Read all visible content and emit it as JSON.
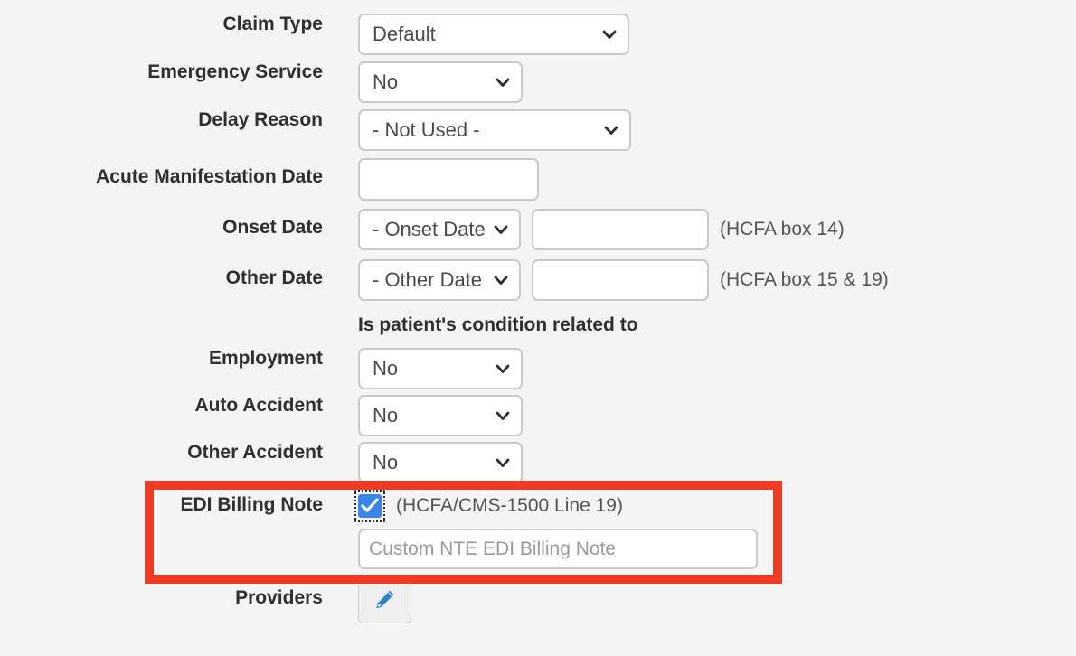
{
  "theme": {
    "page_background": "#f4f4f4",
    "label_color": "#2f2f2f",
    "field_border": "#c9c9c9",
    "field_background": "#ffffff",
    "hint_color": "#555555",
    "placeholder_color": "#9a9a9a",
    "highlight_color": "#ee3b24",
    "checkbox_checked_color": "#3a86e8",
    "pencil_icon_color": "#2f81c4"
  },
  "form": {
    "section_heading": "Is patient's condition related to",
    "rows": {
      "claim_type": {
        "label": "Claim Type",
        "select_value": "Default",
        "chevron_icon": "chevron-down-icon"
      },
      "emergency_service": {
        "label": "Emergency Service",
        "select_value": "No",
        "chevron_icon": "chevron-down-icon"
      },
      "delay_reason": {
        "label": "Delay Reason",
        "select_value": "- Not Used -",
        "chevron_icon": "chevron-down-icon"
      },
      "acute_manifestation_date": {
        "label": "Acute Manifestation Date",
        "input_value": "",
        "placeholder": ""
      },
      "onset_date": {
        "label": "Onset Date",
        "select_value": "- Onset Date -",
        "input_value": "",
        "placeholder": "",
        "hint": "(HCFA box 14)",
        "chevron_icon": "chevron-down-icon"
      },
      "other_date": {
        "label": "Other Date",
        "select_value": "- Other Date -",
        "input_value": "",
        "placeholder": "",
        "hint": "(HCFA box 15 & 19)",
        "chevron_icon": "chevron-down-icon"
      },
      "employment": {
        "label": "Employment",
        "select_value": "No",
        "chevron_icon": "chevron-down-icon"
      },
      "auto_accident": {
        "label": "Auto Accident",
        "select_value": "No",
        "chevron_icon": "chevron-down-icon"
      },
      "other_accident": {
        "label": "Other Accident",
        "select_value": "No",
        "chevron_icon": "chevron-down-icon"
      },
      "edi_billing_note": {
        "label": "EDI Billing Note",
        "checkbox_checked": true,
        "checkbox_icon": "checkmark-icon",
        "hint": "(HCFA/CMS-1500 Line 19)",
        "note_value": "",
        "note_placeholder": "Custom NTE EDI Billing Note"
      },
      "providers": {
        "label": "Providers",
        "button_icon": "pencil-icon",
        "button_label": ""
      }
    }
  }
}
